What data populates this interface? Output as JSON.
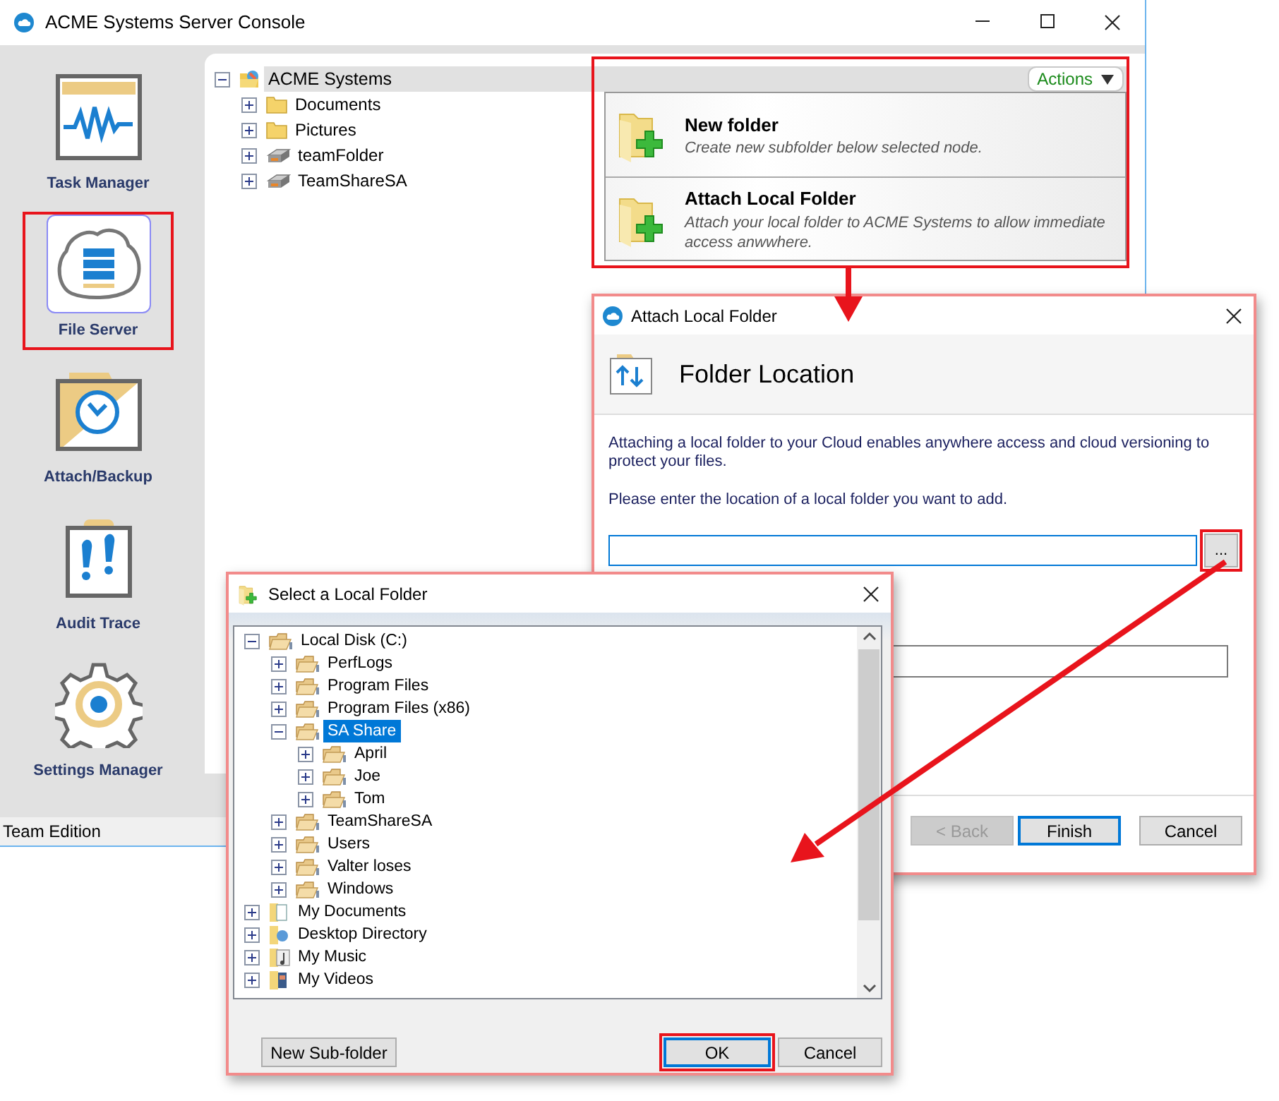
{
  "main_window": {
    "title": "ACME Systems Server Console",
    "sidebar": {
      "items": [
        {
          "label": "Task Manager",
          "kind": "task",
          "selected": false,
          "highlighted": false
        },
        {
          "label": "File Server",
          "kind": "server",
          "selected": true,
          "highlighted": true
        },
        {
          "label": "Attach/Backup",
          "kind": "backup",
          "selected": false,
          "highlighted": false
        },
        {
          "label": "Audit Trace",
          "kind": "audit",
          "selected": false,
          "highlighted": false
        },
        {
          "label": "Settings Manager",
          "kind": "settings",
          "selected": false,
          "highlighted": false
        }
      ]
    },
    "tree": [
      {
        "label": "ACME Systems",
        "kind": "root",
        "expanded": true,
        "selected": true,
        "children": [
          {
            "label": "Documents",
            "kind": "folder",
            "expanded": false,
            "selected": false
          },
          {
            "label": "Pictures",
            "kind": "folder",
            "expanded": false,
            "selected": false
          },
          {
            "label": "teamFolder",
            "kind": "share",
            "expanded": false,
            "selected": false
          },
          {
            "label": "TeamShareSA",
            "kind": "share",
            "expanded": false,
            "selected": false
          }
        ]
      }
    ],
    "actions": {
      "button": "Actions",
      "highlighted": true,
      "items": [
        {
          "title": "New folder",
          "description": "Create new subfolder below selected node."
        },
        {
          "title": "Attach Local Folder",
          "description": "Attach your local folder to ACME Systems to allow immediate access anwwhere."
        }
      ]
    },
    "status_bar": "Team Edition"
  },
  "attach_dialog": {
    "title": "Attach Local Folder",
    "heading": "Folder Location",
    "intro": "Attaching a local folder to your Cloud enables anywhere access and cloud versioning to protect your files.",
    "prompt": "Please enter the location of a local folder you want to add.",
    "browse_button": {
      "label": "...",
      "highlighted": true
    },
    "buttons": [
      {
        "label": "< Back",
        "disabled": true,
        "default": false
      },
      {
        "label": "Finish",
        "disabled": false,
        "default": true
      },
      {
        "label": "Cancel",
        "disabled": false,
        "default": false
      }
    ]
  },
  "select_dialog": {
    "title": "Select a Local Folder",
    "tree": [
      {
        "label": "Local Disk (C:)",
        "kind": "disk",
        "expanded": true,
        "selected": false,
        "children": [
          {
            "label": "PerfLogs",
            "kind": "disk",
            "expanded": false,
            "selected": false
          },
          {
            "label": "Program Files",
            "kind": "disk",
            "expanded": false,
            "selected": false
          },
          {
            "label": "Program Files (x86)",
            "kind": "disk",
            "expanded": false,
            "selected": false
          },
          {
            "label": "SA Share",
            "kind": "disk",
            "expanded": true,
            "selected": true,
            "children": [
              {
                "label": "April",
                "kind": "disk",
                "expanded": false,
                "selected": false
              },
              {
                "label": "Joe",
                "kind": "disk",
                "expanded": false,
                "selected": false
              },
              {
                "label": "Tom",
                "kind": "disk",
                "expanded": false,
                "selected": false
              }
            ]
          },
          {
            "label": "TeamShareSA",
            "kind": "disk",
            "expanded": false,
            "selected": false
          },
          {
            "label": "Users",
            "kind": "disk",
            "expanded": false,
            "selected": false
          },
          {
            "label": "Valter loses",
            "kind": "disk",
            "expanded": false,
            "selected": false
          },
          {
            "label": "Windows",
            "kind": "disk",
            "expanded": false,
            "selected": false
          }
        ]
      },
      {
        "label": "My Documents",
        "kind": "documents",
        "expanded": false,
        "selected": false
      },
      {
        "label": "Desktop Directory",
        "kind": "desktop",
        "expanded": false,
        "selected": false
      },
      {
        "label": "My Music",
        "kind": "music",
        "expanded": false,
        "selected": false
      },
      {
        "label": "My Videos",
        "kind": "videos",
        "expanded": false,
        "selected": false
      }
    ],
    "buttons": [
      {
        "label": "New Sub-folder",
        "kind": "left",
        "highlighted": false,
        "default": false
      },
      {
        "label": "OK",
        "kind": "right",
        "highlighted": true,
        "default": true
      },
      {
        "label": "Cancel",
        "kind": "right",
        "highlighted": false,
        "default": false
      }
    ]
  }
}
